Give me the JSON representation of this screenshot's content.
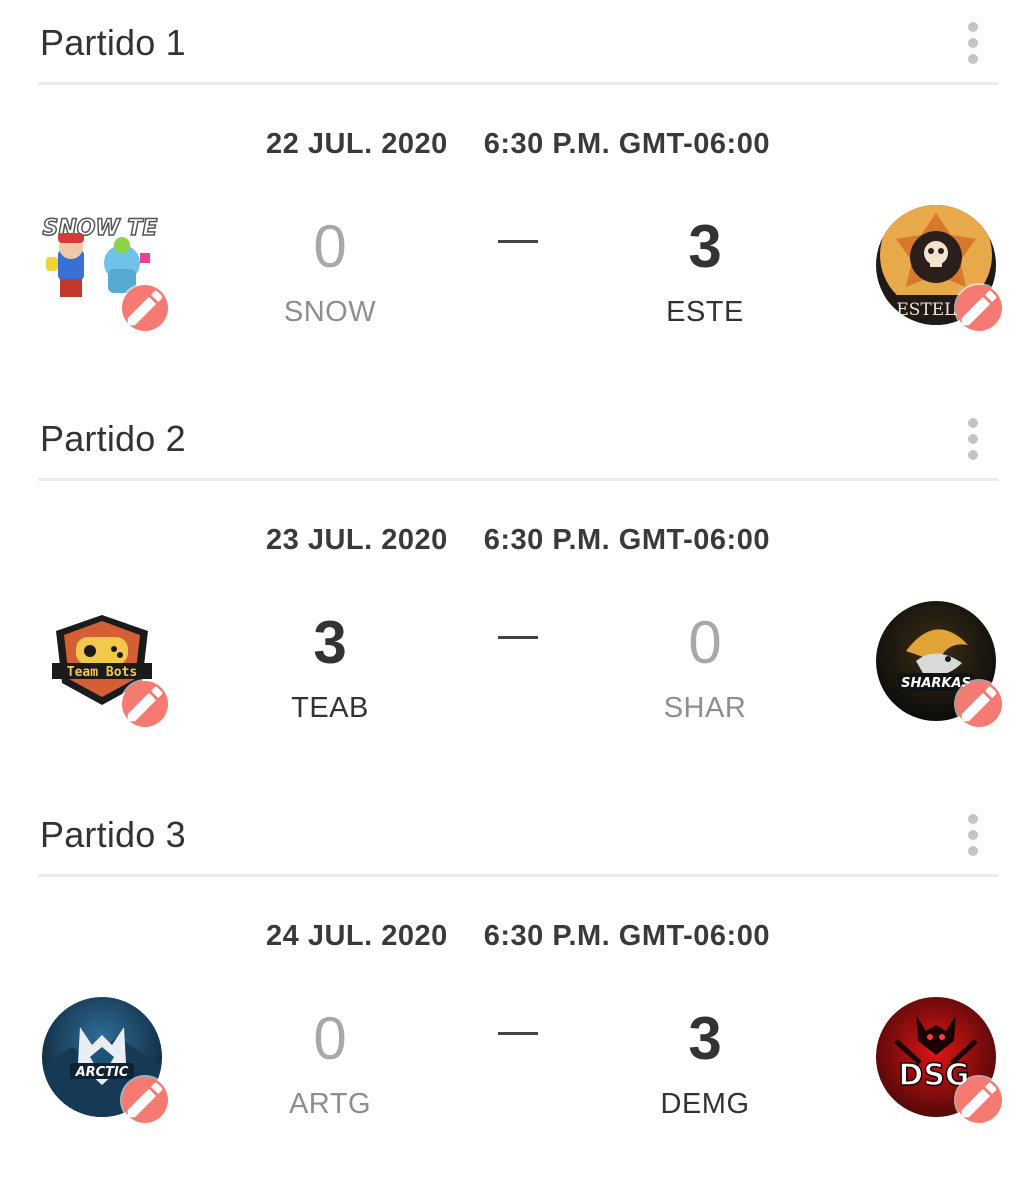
{
  "colors": {
    "accent_edit": "#f47a72",
    "divider": "#ececec",
    "winner_text": "#333333",
    "loser_text": "#a8a8a8"
  },
  "matches": [
    {
      "title": "Partido 1",
      "date": "22 JUL. 2020",
      "time": "6:30 P.M. GMT-06:00",
      "separator": "—",
      "home": {
        "abbr": "SNOW",
        "score": "0",
        "logo_icon": "snow-team-logo",
        "result": "lose"
      },
      "away": {
        "abbr": "ESTE",
        "score": "3",
        "logo_icon": "estelar-team-logo",
        "result": "win"
      }
    },
    {
      "title": "Partido 2",
      "date": "23 JUL. 2020",
      "time": "6:30 P.M. GMT-06:00",
      "separator": "—",
      "home": {
        "abbr": "TEAB",
        "score": "3",
        "logo_icon": "team-bots-logo",
        "result": "win"
      },
      "away": {
        "abbr": "SHAR",
        "score": "0",
        "logo_icon": "sharkas-team-logo",
        "result": "lose"
      }
    },
    {
      "title": "Partido 3",
      "date": "24 JUL. 2020",
      "time": "6:30 P.M. GMT-06:00",
      "separator": "—",
      "home": {
        "abbr": "ARTG",
        "score": "0",
        "logo_icon": "arctic-gaming-logo",
        "result": "lose"
      },
      "away": {
        "abbr": "DEMG",
        "score": "3",
        "logo_icon": "dsg-team-logo",
        "result": "win"
      }
    }
  ],
  "logo_text": {
    "snow": "SNOW TE",
    "estelar": "ESTELA",
    "teambots": "Team Bots",
    "sharkas": "SHARKAS",
    "arctic": "ARCTIC",
    "dsg": "DSG"
  },
  "icons": {
    "menu": "more-vertical-icon",
    "edit": "pencil-icon"
  }
}
